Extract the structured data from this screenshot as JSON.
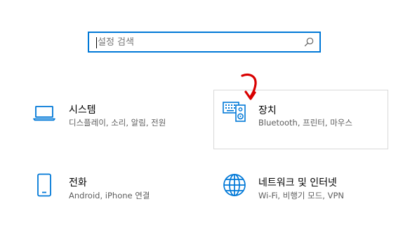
{
  "search": {
    "placeholder": "설정 검색",
    "icon": "search-icon"
  },
  "categories": [
    {
      "title": "시스템",
      "description": "디스플레이, 소리, 알림, 전원",
      "icon": "laptop-icon"
    },
    {
      "title": "장치",
      "description": "Bluetooth, 프린터, 마우스",
      "icon": "keyboard-speaker-icon"
    },
    {
      "title": "전화",
      "description": "Android, iPhone 연결",
      "icon": "phone-icon"
    },
    {
      "title": "네트워크 및 인터넷",
      "description": "Wi-Fi, 비행기 모드, VPN",
      "icon": "globe-icon"
    }
  ],
  "annotation": {
    "icon": "red-arrow-icon",
    "color": "#d90000"
  },
  "colors": {
    "accent": "#0078d7",
    "tile_border": "#d9d9d9",
    "description_text": "#5d5d5d"
  }
}
